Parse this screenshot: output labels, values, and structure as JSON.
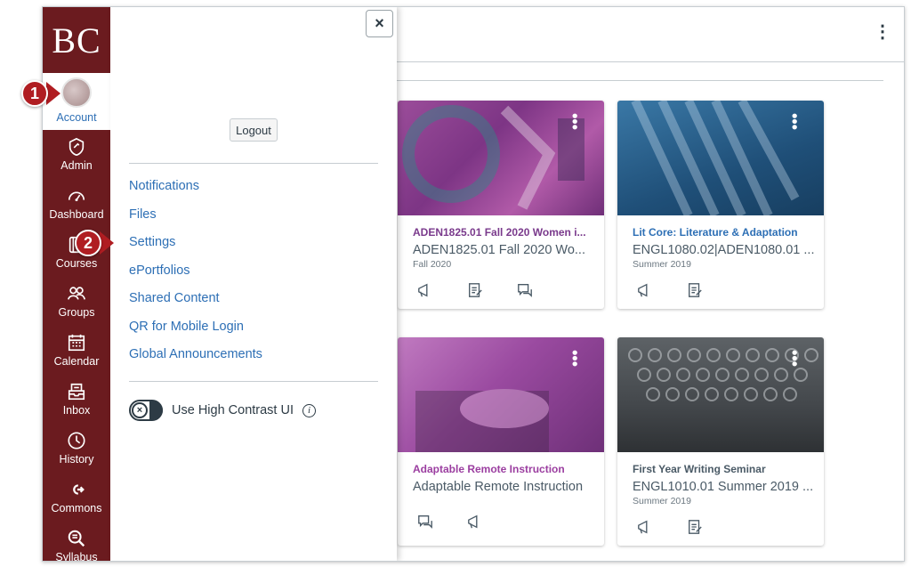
{
  "logo": "BC",
  "account": {
    "label": "Account"
  },
  "nav": [
    {
      "label": "Admin",
      "icon": "admin-icon"
    },
    {
      "label": "Dashboard",
      "icon": "dashboard-icon"
    },
    {
      "label": "Courses",
      "icon": "courses-icon"
    },
    {
      "label": "Groups",
      "icon": "groups-icon"
    },
    {
      "label": "Calendar",
      "icon": "calendar-icon"
    },
    {
      "label": "Inbox",
      "icon": "inbox-icon"
    },
    {
      "label": "History",
      "icon": "history-icon"
    },
    {
      "label": "Commons",
      "icon": "commons-icon"
    },
    {
      "label": "Syllabus",
      "icon": "syllabus-icon"
    }
  ],
  "tray": {
    "close": "×",
    "logout": "Logout",
    "links": [
      "Notifications",
      "Files",
      "Settings",
      "ePortfolios",
      "Shared Content",
      "QR for Mobile Login",
      "Global Announcements"
    ],
    "contrast_label": "Use High Contrast UI",
    "toggle_glyph": "×",
    "info_glyph": "i"
  },
  "cards": [
    {
      "title": "ADEN1825.01 Fall 2020 Women i...",
      "code": "ADEN1825.01 Fall 2020 Wo...",
      "term": "Fall 2020",
      "color": "#8a3a8c",
      "title_color": "#7a3a8c"
    },
    {
      "title": "Lit Core: Literature & Adaptation",
      "code": "ENGL1080.02|ADEN1080.01 ...",
      "term": "Summer 2019",
      "color": "#2a5f8a",
      "title_color": "#2d6fb5"
    },
    {
      "title": "Adaptable Remote Instruction",
      "code": "Adaptable Remote Instruction",
      "term": "",
      "color": "#a04ba0",
      "title_color": "#9b3ea0"
    },
    {
      "title": "First Year Writing Seminar",
      "code": "ENGL1010.01 Summer 2019 ...",
      "term": "Summer 2019",
      "color": "#555b60",
      "title_color": "#4a5a66"
    }
  ],
  "callouts": [
    "1",
    "2"
  ],
  "colors": {
    "nav_bg": "#6b1b1f",
    "link": "#2d6fb5",
    "callout": "#b01d22"
  }
}
